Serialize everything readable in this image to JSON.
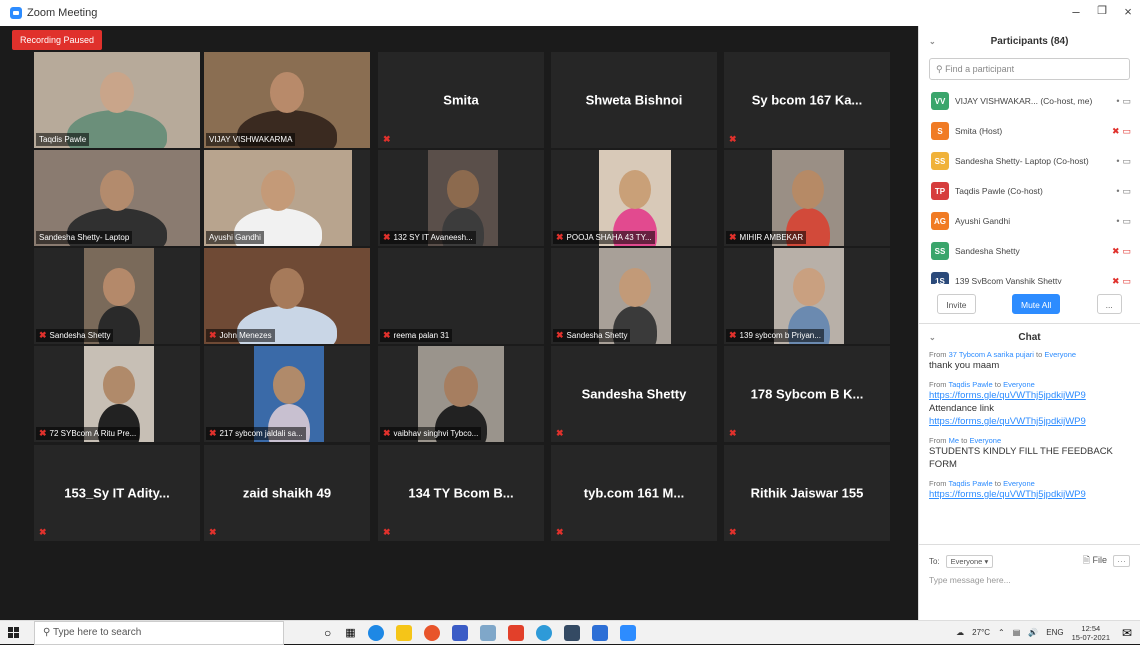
{
  "window": {
    "title": "Zoom Meeting"
  },
  "recording": {
    "label": "Recording Paused"
  },
  "tiles": [
    {
      "name": "Taqdis Pawle",
      "video": true,
      "muted": false
    },
    {
      "name": "VIJAY VISHWAKARMA",
      "video": true,
      "muted": false,
      "active": true
    },
    {
      "name": "Smita",
      "video": false,
      "muted": true
    },
    {
      "name": "Shweta Bishnoi",
      "video": false,
      "muted": false
    },
    {
      "name": "Sy bcom 167 Ka...",
      "video": false,
      "muted": true
    },
    {
      "name": "Sandesha Shetty- Laptop",
      "video": true,
      "muted": false
    },
    {
      "name": "Ayushi Gandhi",
      "video": true,
      "muted": false
    },
    {
      "name": "132 SY IT  Avaneesh...",
      "video": true,
      "muted": true
    },
    {
      "name": "POOJA SHAHA 43 TY...",
      "video": true,
      "muted": true
    },
    {
      "name": "MIHIR AMBEKAR",
      "video": true,
      "muted": true
    },
    {
      "name": "Sandesha Shetty",
      "video": true,
      "muted": true
    },
    {
      "name": "John Menezes",
      "video": true,
      "muted": true
    },
    {
      "name": "reema palan 31",
      "video": false,
      "muted": true,
      "labelOnly": true
    },
    {
      "name": "Sandesha Shetty",
      "video": true,
      "muted": true
    },
    {
      "name": "139 sybcom b Priyan...",
      "video": true,
      "muted": true
    },
    {
      "name": "72 SYBcom A Ritu Pre...",
      "video": true,
      "muted": true
    },
    {
      "name": "217 sybcom jaldali sa...",
      "video": true,
      "muted": true
    },
    {
      "name": "vaibhav singhvi Tybco...",
      "video": true,
      "muted": true
    },
    {
      "name": "Sandesha Shetty",
      "video": false,
      "muted": true
    },
    {
      "name": "178 Sybcom B K...",
      "video": false,
      "muted": true
    },
    {
      "name": "153_Sy IT  Adity...",
      "video": false,
      "muted": true
    },
    {
      "name": "zaid shaikh 49",
      "video": false,
      "muted": true
    },
    {
      "name": "134 TY Bcom B...",
      "video": false,
      "muted": true
    },
    {
      "name": "tyb.com 161 M...",
      "video": false,
      "muted": true
    },
    {
      "name": "Rithik Jaiswar 155",
      "video": false,
      "muted": true
    }
  ],
  "participants": {
    "title": "Participants (84)",
    "search_placeholder": "Find a participant",
    "list": [
      {
        "initials": "VV",
        "color": "#3aa56b",
        "name": "VIJAY VISHWAKAR...  (Co-host, me)",
        "mutedRed": false
      },
      {
        "initials": "S",
        "color": "#f07b24",
        "name": "Smita (Host)",
        "mutedRed": true
      },
      {
        "initials": "SS",
        "color": "#f0b23a",
        "name": "Sandesha Shetty- Laptop (Co-host)",
        "mutedRed": false
      },
      {
        "initials": "TP",
        "color": "#d63d3d",
        "name": "Taqdis Pawle (Co-host)",
        "mutedRed": false
      },
      {
        "initials": "AG",
        "color": "#f07b24",
        "name": "Ayushi Gandhi",
        "mutedRed": false
      },
      {
        "initials": "SS",
        "color": "#3aa56b",
        "name": "Sandesha Shetty",
        "mutedRed": true
      },
      {
        "initials": "1S",
        "color": "#2b4a7a",
        "name": "139 SyBcom Vanshik Shetty",
        "mutedRed": true
      }
    ],
    "invite_label": "Invite",
    "mute_all_label": "Mute All",
    "more_label": "..."
  },
  "chat": {
    "title": "Chat",
    "messages": [
      {
        "from": "From",
        "who": "37 Tybcom A sarika pujari",
        "to": "to",
        "target": "Everyone",
        "lines": [
          {
            "text": "thank you maam",
            "link": false
          }
        ]
      },
      {
        "from": "From",
        "who": "Taqdis Pawle",
        "to": "to",
        "target": "Everyone",
        "lines": [
          {
            "text": "https://forms.gle/quVWThj5jpdkijWP9",
            "link": true
          },
          {
            "text": "Attendance link",
            "link": false
          },
          {
            "text": "https://forms.gle/quVWThj5jpdkijWP9",
            "link": true
          }
        ]
      },
      {
        "from": "From",
        "who": "Me",
        "to": "to",
        "target": "Everyone",
        "lines": [
          {
            "text": "STUDENTS KINDLY FILL THE FEEDBACK FORM",
            "link": false
          }
        ]
      },
      {
        "from": "From",
        "who": "Taqdis Pawle",
        "to": "to",
        "target": "Everyone",
        "lines": [
          {
            "text": "https://forms.gle/quVWThj5jpdkijWP9",
            "link": true
          }
        ]
      }
    ],
    "to_label": "To:",
    "to_value": "Everyone",
    "file_label": "File",
    "more_label": "···",
    "input_placeholder": "Type message here..."
  },
  "taskbar": {
    "search_placeholder": "Type here to search",
    "temperature": "27°C",
    "language": "ENG",
    "time": "12:54",
    "date": "15-07-2021"
  }
}
